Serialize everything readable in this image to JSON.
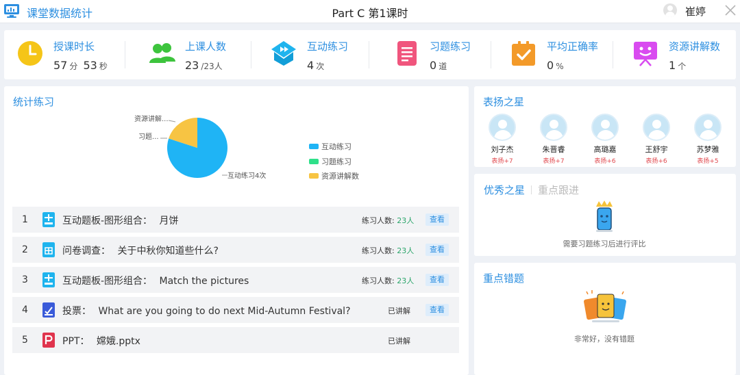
{
  "app": {
    "title": "课堂数据统计",
    "lesson": "Part C 第1课时",
    "user": "崔婷"
  },
  "stats": [
    {
      "label": "授课时长",
      "parts": [
        "57",
        "分",
        "53",
        "秒"
      ],
      "icon": "clock-icon",
      "color": "#f5c518"
    },
    {
      "label": "上课人数",
      "parts": [
        "23",
        "/23人"
      ],
      "icon": "people-icon",
      "color": "#3dc43d"
    },
    {
      "label": "互动练习",
      "parts": [
        "4",
        "次"
      ],
      "icon": "interactive-icon",
      "color": "#1fb4ee"
    },
    {
      "label": "习题练习",
      "parts": [
        "0",
        "道"
      ],
      "icon": "exercise-doc-icon",
      "color": "#f0557d"
    },
    {
      "label": "平均正确率",
      "parts": [
        "0",
        "%"
      ],
      "icon": "clipboard-check-icon",
      "color": "#f39a29"
    },
    {
      "label": "资源讲解数",
      "parts": [
        "1",
        "个"
      ],
      "icon": "presentation-icon",
      "color": "#d94bf0"
    }
  ],
  "practice": {
    "title": "统计练习",
    "pie": {
      "slice_labels": [
        "互动练习4次",
        "习题...",
        "资源讲解..."
      ],
      "legend": [
        "互动练习",
        "习题练习",
        "资源讲解数"
      ]
    },
    "exercises": [
      {
        "num": "1",
        "type": "互动题板-图形组合：",
        "name": "月饼",
        "count_label": "练习人数:",
        "count": "23人",
        "status": "",
        "action": "查看",
        "icon": "interactive-board-icon",
        "color": "#1fb4ee"
      },
      {
        "num": "2",
        "type": "问卷调查：",
        "name": "关于中秋你知道些什么?",
        "count_label": "练习人数:",
        "count": "23人",
        "status": "",
        "action": "查看",
        "icon": "survey-icon",
        "color": "#1fb4ee"
      },
      {
        "num": "3",
        "type": "互动题板-图形组合：",
        "name": "Match the pictures",
        "count_label": "练习人数:",
        "count": "23人",
        "status": "",
        "action": "查看",
        "icon": "interactive-board-icon",
        "color": "#1fb4ee"
      },
      {
        "num": "4",
        "type": "投票：",
        "name": "What are you going to do next Mid-Autumn Festival?",
        "count_label": "",
        "count": "",
        "status": "已讲解",
        "action": "查看",
        "icon": "vote-icon",
        "color": "#3a5bd9"
      },
      {
        "num": "5",
        "type": "PPT：",
        "name": "嫦娥.pptx",
        "count_label": "",
        "count": "",
        "status": "已讲解",
        "action": "",
        "icon": "ppt-icon",
        "color": "#e0344d"
      }
    ]
  },
  "chart_data": {
    "type": "pie",
    "labels": [
      "互动练习",
      "习题练习",
      "资源讲解数"
    ],
    "values": [
      4,
      0,
      1
    ],
    "colors": [
      "#1fb4f5",
      "#2fe08a",
      "#f7c443"
    ]
  },
  "praise_stars": {
    "title": "表扬之星",
    "students": [
      {
        "name": "刘子杰",
        "praise": "表扬+7"
      },
      {
        "name": "朱晋睿",
        "praise": "表扬+7"
      },
      {
        "name": "高璐嘉",
        "praise": "表扬+6"
      },
      {
        "name": "王舒宇",
        "praise": "表扬+6"
      },
      {
        "name": "苏梦雅",
        "praise": "表扬+5"
      }
    ]
  },
  "excellent": {
    "tabs": [
      "优秀之星",
      "重点跟进"
    ],
    "empty_hint": "需要习题练习后进行评比"
  },
  "mistakes": {
    "title": "重点错题",
    "empty_hint": "非常好，没有错题"
  }
}
